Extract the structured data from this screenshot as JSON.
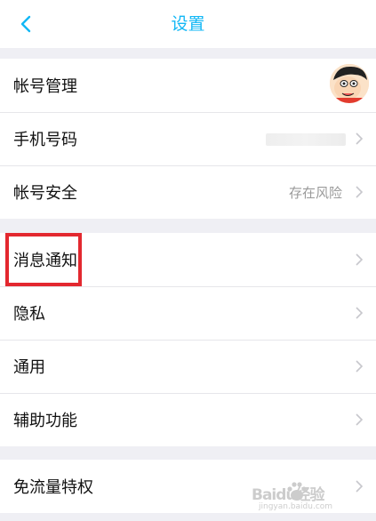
{
  "navbar": {
    "title": "设置",
    "back_icon": "chevron-left-icon",
    "accent_color": "#12b7f5"
  },
  "groups": [
    {
      "items": [
        {
          "label": "帐号管理",
          "value": "",
          "accessory": "avatar"
        },
        {
          "label": "手机号码",
          "value": "",
          "accessory": "masked-value"
        },
        {
          "label": "帐号安全",
          "value": "存在风险",
          "accessory": "chevron"
        }
      ]
    },
    {
      "items": [
        {
          "label": "消息通知",
          "value": "",
          "accessory": "chevron"
        },
        {
          "label": "隐私",
          "value": "",
          "accessory": "chevron"
        },
        {
          "label": "通用",
          "value": "",
          "accessory": "chevron"
        },
        {
          "label": "辅助功能",
          "value": "",
          "accessory": "chevron"
        }
      ]
    },
    {
      "items": [
        {
          "label": "免流量特权",
          "value": "",
          "accessory": "chevron"
        }
      ]
    }
  ],
  "highlight": {
    "target": "消息通知",
    "color": "#e3282f"
  },
  "watermark": {
    "line1": "Baidu经验",
    "line2": "jingyan.baidu.com"
  },
  "colors": {
    "background": "#efeff4",
    "divider": "#e6e6ea",
    "secondary_text": "#9a9a9a"
  }
}
